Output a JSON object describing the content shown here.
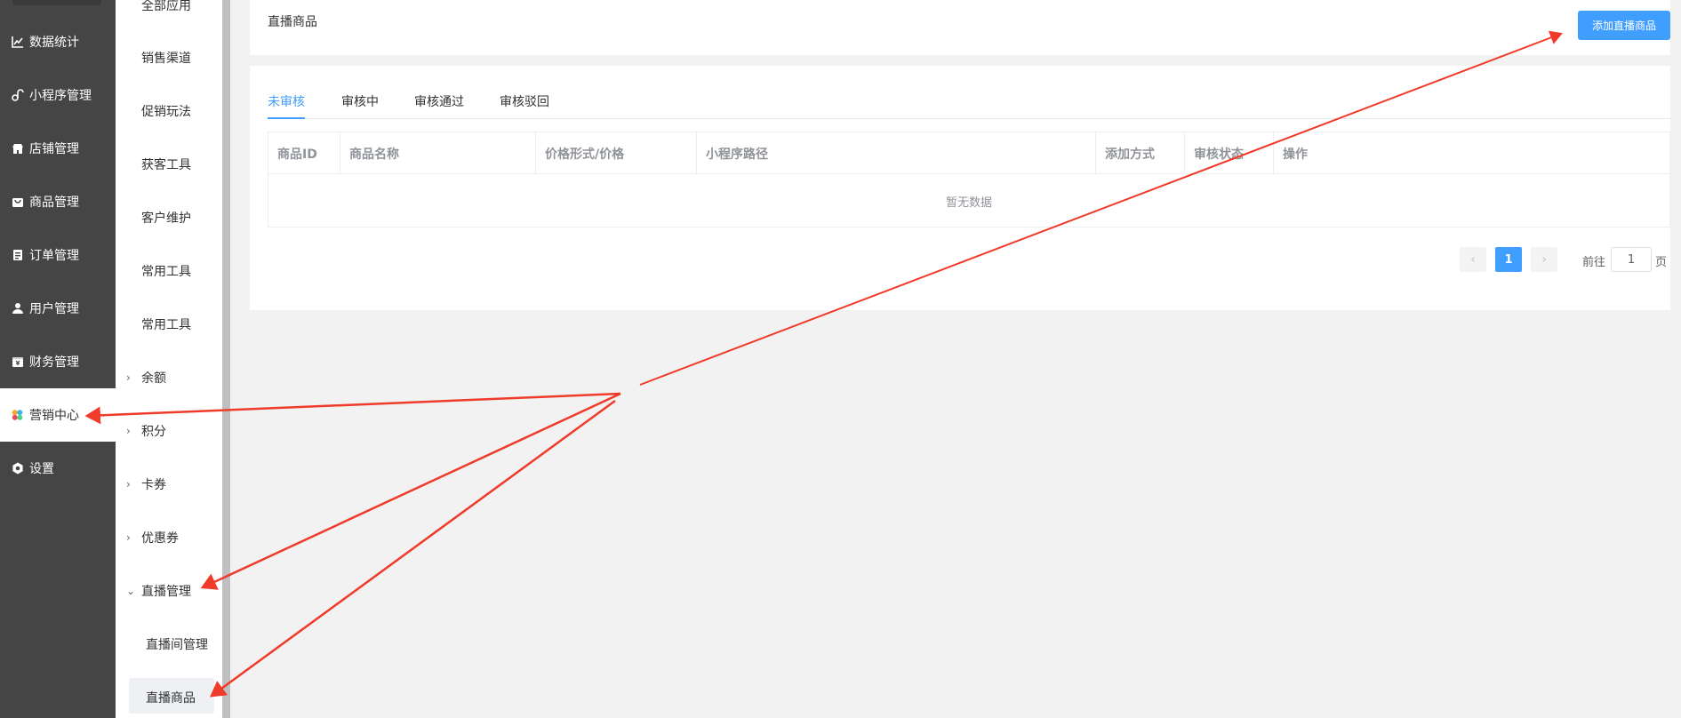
{
  "sidebar_main": {
    "items": [
      {
        "label": "数据统计",
        "icon": "chart-line-icon"
      },
      {
        "label": "小程序管理",
        "icon": "link-icon"
      },
      {
        "label": "店铺管理",
        "icon": "store-icon"
      },
      {
        "label": "商品管理",
        "icon": "bag-icon"
      },
      {
        "label": "订单管理",
        "icon": "clipboard-icon"
      },
      {
        "label": "用户管理",
        "icon": "user-icon"
      },
      {
        "label": "财务管理",
        "icon": "finance-icon"
      },
      {
        "label": "营销中心",
        "icon": "marketing-icon"
      },
      {
        "label": "设置",
        "icon": "gear-icon"
      }
    ]
  },
  "sidebar_sub": {
    "items": [
      {
        "label": "全部应用"
      },
      {
        "label": "销售渠道"
      },
      {
        "label": "促销玩法"
      },
      {
        "label": "获客工具"
      },
      {
        "label": "客户维护"
      },
      {
        "label": "常用工具"
      },
      {
        "label": "常用工具"
      },
      {
        "label": "余额"
      },
      {
        "label": "积分"
      },
      {
        "label": "卡券"
      },
      {
        "label": "优惠券"
      },
      {
        "label": "直播管理"
      },
      {
        "label": "直播间管理"
      },
      {
        "label": "直播商品"
      }
    ]
  },
  "header": {
    "title": "直播商品",
    "add_button": "添加直播商品"
  },
  "tabs": [
    "未审核",
    "审核中",
    "审核通过",
    "审核驳回"
  ],
  "table": {
    "columns": [
      "商品ID",
      "商品名称",
      "价格形式/价格",
      "小程序路径",
      "添加方式",
      "审核状态",
      "操作"
    ],
    "empty_text": "暂无数据"
  },
  "pagination": {
    "current_page": "1",
    "goto_label": "前往",
    "goto_value": "1",
    "page_suffix": "页"
  },
  "colors": {
    "accent": "#409eff",
    "sidebar_bg": "#454545",
    "annotation_arrow": "#f03a2a"
  }
}
